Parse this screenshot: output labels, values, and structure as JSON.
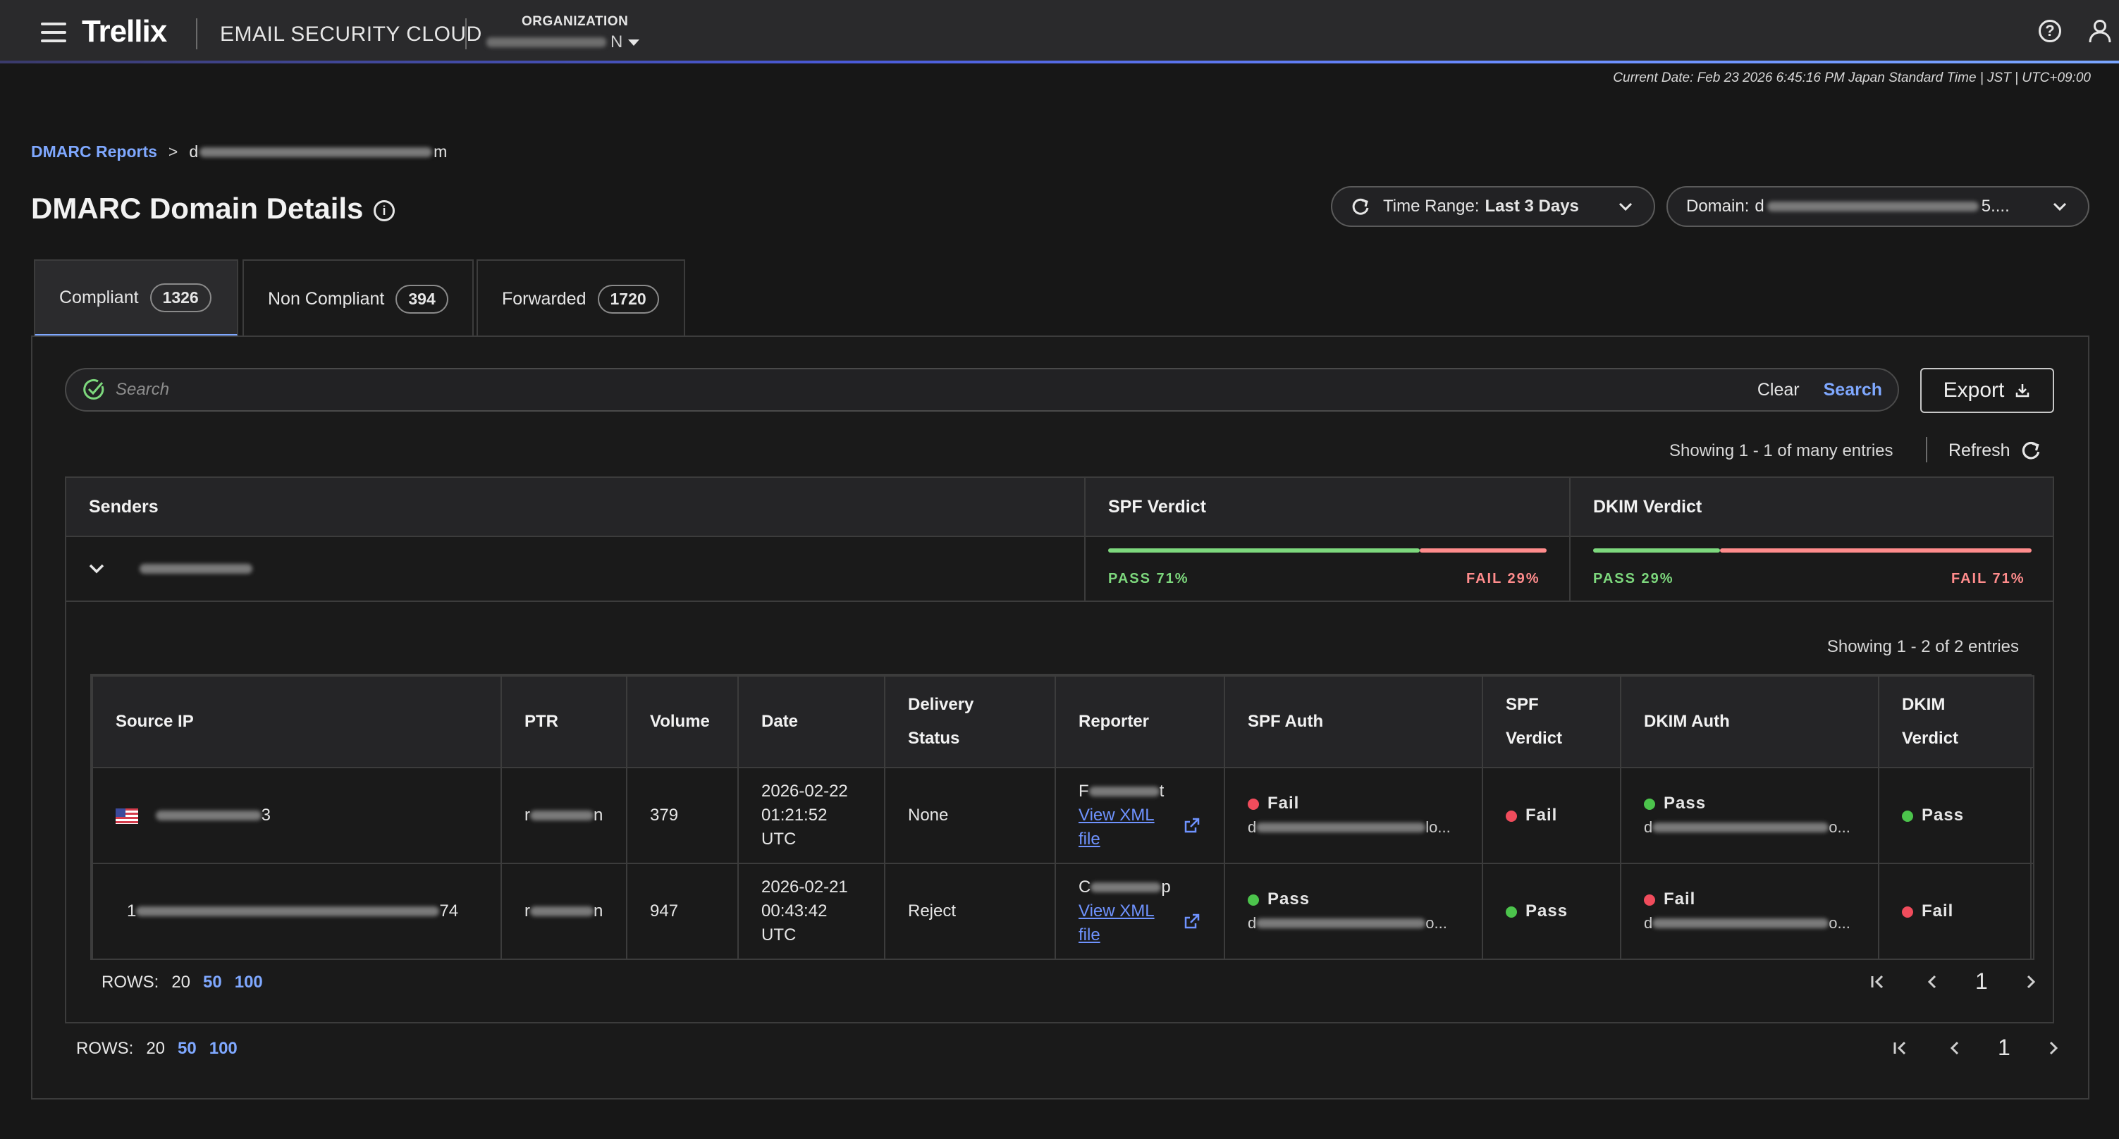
{
  "header": {
    "logo": "Trellix",
    "product": "EMAIL SECURITY CLOUD",
    "org_label": "ORGANIZATION",
    "org_value_suffix": "N"
  },
  "current_date": "Current Date: Feb 23 2026 6:45:16 PM Japan Standard Time | JST | UTC+09:00",
  "breadcrumb": {
    "root": "DMARC Reports",
    "sep": ">",
    "leaf_prefix": "d",
    "leaf_suffix": "m"
  },
  "page_title": "DMARC Domain Details",
  "filters": {
    "time_range_label": "Time Range:",
    "time_range_value": "Last 3 Days",
    "domain_label": "Domain:",
    "domain_value_prefix": "d",
    "domain_value_suffix": "5...."
  },
  "tabs": [
    {
      "label": "Compliant",
      "count": "1326",
      "active": true
    },
    {
      "label": "Non Compliant",
      "count": "394",
      "active": false
    },
    {
      "label": "Forwarded",
      "count": "1720",
      "active": false
    }
  ],
  "search": {
    "placeholder": "Search",
    "clear": "Clear",
    "go": "Search"
  },
  "export_label": "Export",
  "showing_top": "Showing 1 - 1 of many entries",
  "refresh_label": "Refresh",
  "outer_table": {
    "headers": {
      "senders": "Senders",
      "spf": "SPF Verdict",
      "dkim": "DKIM Verdict"
    },
    "spf": {
      "pass_label": "PASS 71%",
      "fail_label": "FAIL 29%",
      "pass_pct": 71,
      "pass_color": "#7dd87d",
      "fail_color": "#ff8c8c"
    },
    "dkim": {
      "pass_label": "PASS 29%",
      "fail_label": "FAIL 71%",
      "pass_pct": 29,
      "pass_color": "#7dd87d",
      "fail_color": "#ff8c8c"
    }
  },
  "showing_inner": "Showing 1 - 2 of 2 entries",
  "inner_table": {
    "headers": {
      "source_ip": "Source IP",
      "ptr": "PTR",
      "volume": "Volume",
      "date": "Date",
      "delivery_status_1": "Delivery",
      "delivery_status_2": "Status",
      "reporter": "Reporter",
      "spf_auth": "SPF Auth",
      "spf_verdict_1": "SPF",
      "spf_verdict_2": "Verdict",
      "dkim_auth": "DKIM Auth",
      "dkim_verdict_1": "DKIM",
      "dkim_verdict_2": "Verdict"
    },
    "rows": [
      {
        "ip_suffix": "3",
        "ptr_prefix": "r",
        "ptr_suffix": "n",
        "volume": "379",
        "date_1": "2026-02-22",
        "date_2": "01:21:52",
        "date_3": "UTC",
        "delivery": "None",
        "reporter_prefix": "F",
        "reporter_suffix": "t",
        "xml_1": "View XML",
        "xml_2": "file",
        "spf_auth": "Fail",
        "spf_auth_sub_prefix": "d",
        "spf_auth_sub_suffix": "lo...",
        "spf_verdict": "Fail",
        "dkim_auth": "Pass",
        "dkim_auth_sub_prefix": "d",
        "dkim_auth_sub_suffix": "o...",
        "dkim_verdict": "Pass"
      },
      {
        "ip_prefix": "1",
        "ip_suffix": "74",
        "ptr_prefix": "r",
        "ptr_suffix": "n",
        "volume": "947",
        "date_1": "2026-02-21",
        "date_2": "00:43:42",
        "date_3": "UTC",
        "delivery": "Reject",
        "reporter_prefix": "C",
        "reporter_suffix": "p",
        "xml_1": "View XML",
        "xml_2": "file",
        "spf_auth": "Pass",
        "spf_auth_sub_prefix": "d",
        "spf_auth_sub_suffix": "o...",
        "spf_verdict": "Pass",
        "dkim_auth": "Fail",
        "dkim_auth_sub_prefix": "d",
        "dkim_auth_sub_suffix": "o...",
        "dkim_verdict": "Fail"
      }
    ]
  },
  "rows_control": {
    "label": "ROWS:",
    "opt1": "20",
    "opt2": "50",
    "opt3": "100"
  },
  "pager": {
    "page": "1"
  }
}
